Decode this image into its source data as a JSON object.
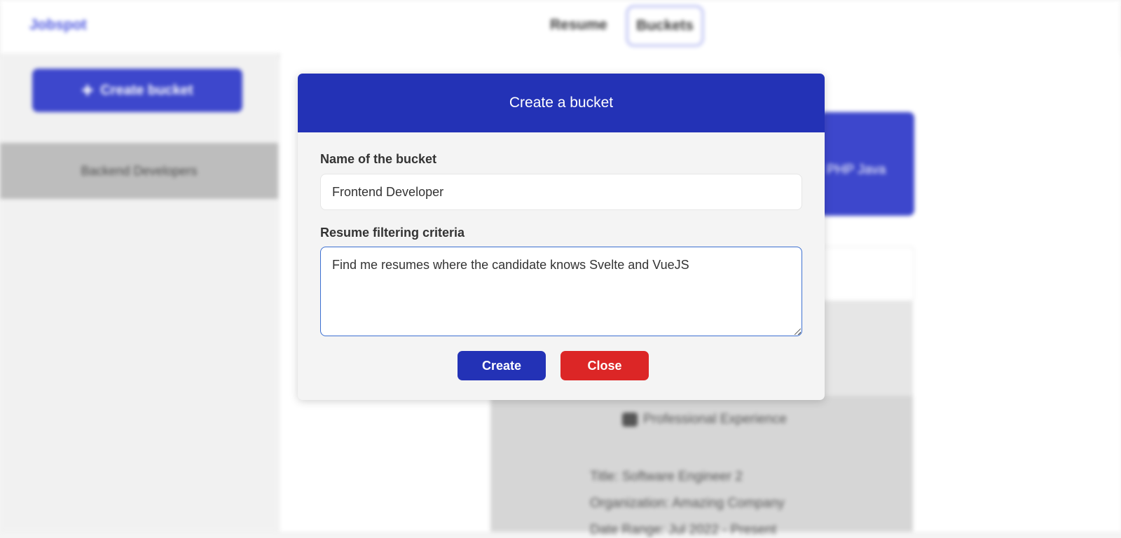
{
  "app": {
    "brand": "Jobspot",
    "nav": {
      "resume": "Resume",
      "buckets": "Buckets"
    }
  },
  "sidebar": {
    "create_bucket_label": "Create bucket",
    "buckets": [
      {
        "label": "Backend Developers"
      }
    ]
  },
  "background": {
    "card_text": "PHP Java",
    "experience": {
      "title": "Professional Experience",
      "lines": [
        "Title: Software Engineer 2",
        "Organization: Amazing Company",
        "Date Range: Jul 2022 - Present"
      ]
    }
  },
  "modal": {
    "title": "Create a bucket",
    "name_label": "Name of the bucket",
    "name_value": "Frontend Developer",
    "criteria_label": "Resume filtering criteria",
    "criteria_value": "Find me resumes where the candidate knows Svelte and VueJS",
    "create_label": "Create",
    "close_label": "Close"
  },
  "colors": {
    "primary": "#2332b6",
    "danger": "#dc2626",
    "brand": "#4d57e0"
  }
}
